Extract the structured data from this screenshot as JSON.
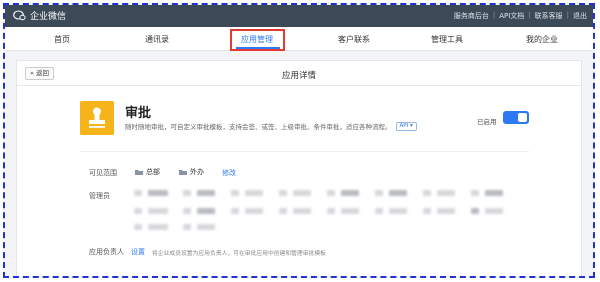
{
  "topbar": {
    "brand": "企业微信",
    "links": [
      "服务商后台",
      "API文档",
      "联系客服",
      "退出"
    ]
  },
  "nav": {
    "tabs": [
      "首页",
      "通讯录",
      "应用管理",
      "客户联系",
      "管理工具",
      "我的企业"
    ],
    "active": "应用管理"
  },
  "card": {
    "back_label": "返回",
    "title": "应用详情",
    "app": {
      "name": "审批",
      "description": "随时随地审批，可自定义审批模板，支持会签、或签、上级审批、条件审批，适应各种流程。",
      "api_badge": "API",
      "enabled_label": "已启用",
      "enabled": true
    },
    "visible_scope": {
      "label": "可见范围",
      "departments": [
        "总部",
        "外办"
      ],
      "edit_label": "修改"
    },
    "admins": {
      "label": "管理员"
    },
    "owner": {
      "label": "应用负责人",
      "set_label": "设置",
      "hint": "将企业成员设置为应用负责人，可在审批应用中创建和管理审批模板"
    }
  },
  "colors": {
    "accent": "#2d78f4",
    "topbar": "#3c4a57",
    "app_icon": "#f4b41a",
    "highlight": "#e53935"
  }
}
